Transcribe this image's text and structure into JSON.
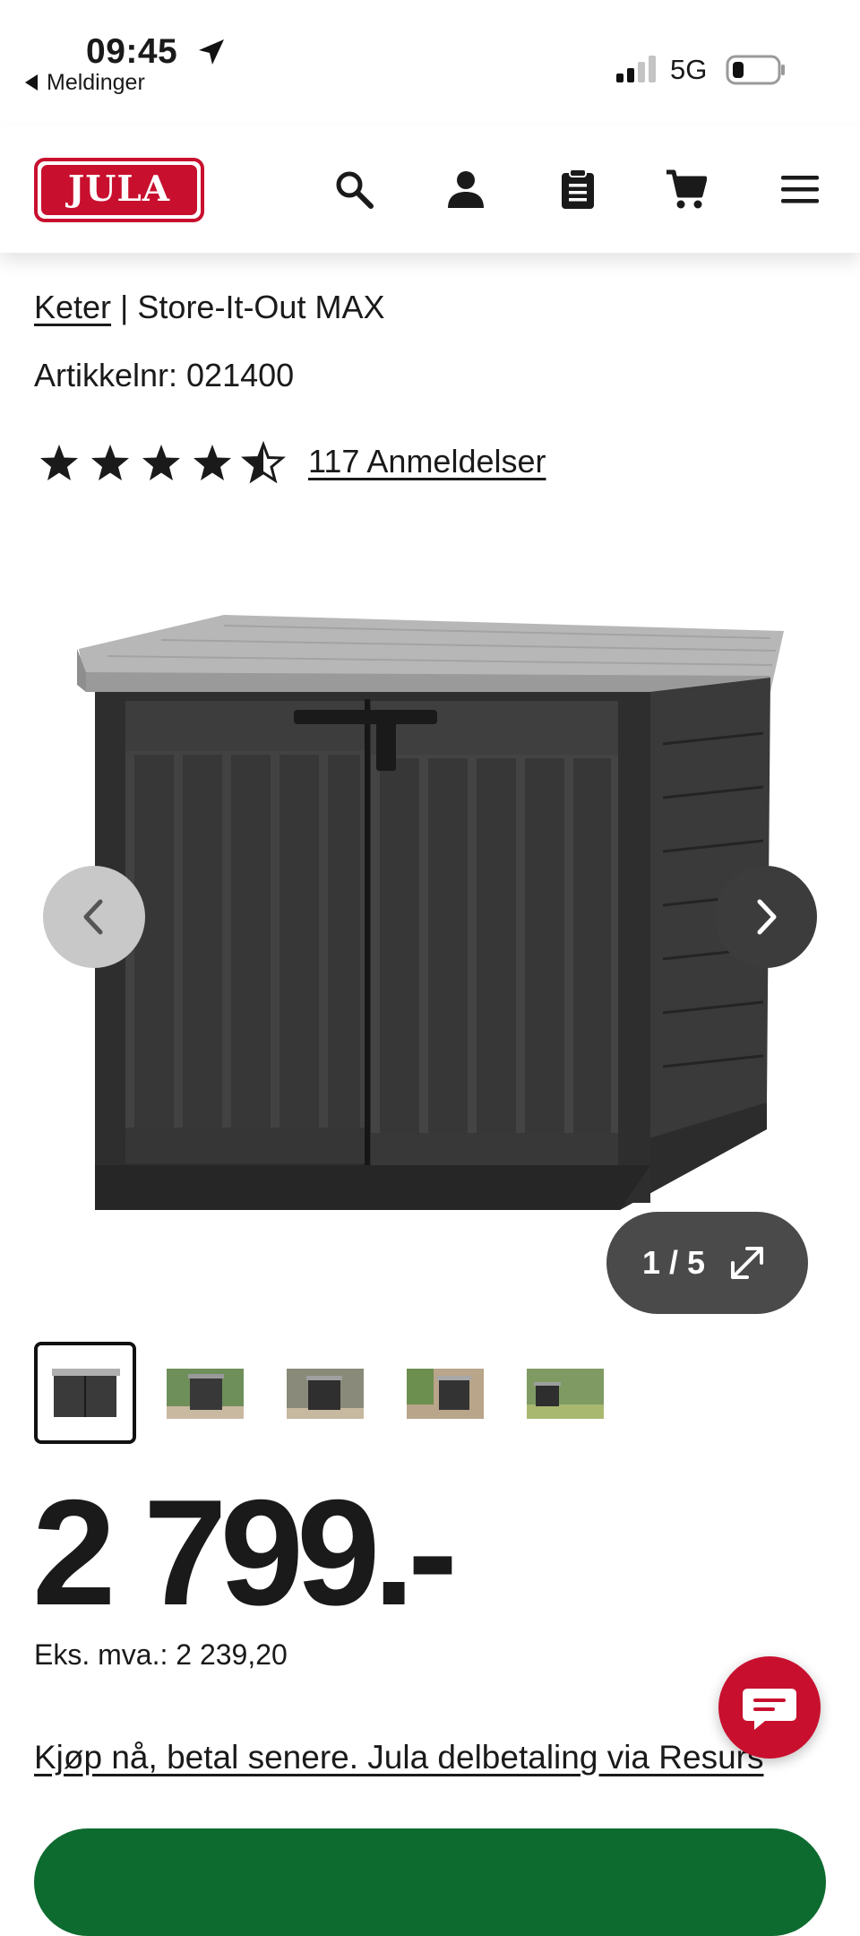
{
  "status_bar": {
    "time": "09:45",
    "back_label": "Meldinger",
    "network": "5G"
  },
  "header": {
    "logo_text": "JULA",
    "icons": [
      "search-icon",
      "account-icon",
      "shopping-list-icon",
      "cart-icon",
      "menu-icon"
    ]
  },
  "product": {
    "brand": "Keter",
    "separator": " | ",
    "name": "Store-It-Out MAX",
    "article_number": "Artikkelnr: 021400",
    "rating": 4.5,
    "reviews_label": "117 Anmeldelser",
    "gallery_counter": "1 / 5",
    "thumbnails_count": 5,
    "price": "2 799.-",
    "ex_vat": "Eks. mva.: 2 239,20",
    "installment_link": "Kjøp nå, betal senere. Jula delbetaling via Resurs"
  },
  "colors": {
    "brand_red": "#c8102e",
    "cta_green": "#0d6b2f",
    "text": "#1a1a1a"
  }
}
